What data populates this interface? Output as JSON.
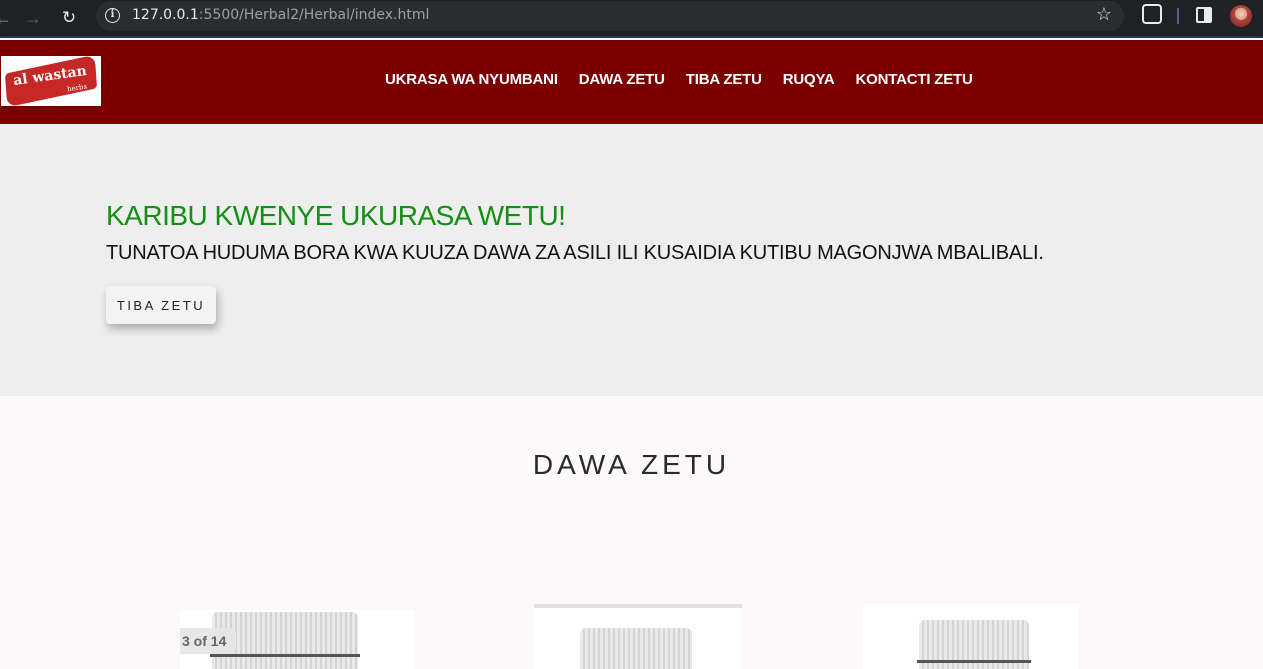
{
  "browser": {
    "url_host": "127.0.0.1",
    "url_rest": ":5500/Herbal2/Herbal/index.html"
  },
  "header": {
    "logo": {
      "text": "al wastan",
      "sub": "herbs",
      "color": "#c62828"
    },
    "nav": [
      {
        "label": "UKRASA WA NYUMBANI"
      },
      {
        "label": "DAWA ZETU"
      },
      {
        "label": "TIBA ZETU"
      },
      {
        "label": "RUQYA"
      },
      {
        "label": "KONTACTI ZETU"
      }
    ],
    "bg_color": "#7a0000"
  },
  "hero": {
    "title": "KARIBU KWENYE UKURASA WETU!",
    "subtitle": "TUNATOA HUDUMA BORA KWA KUUZA DAWA ZA ASILI ILI KUSAIDIA KUTIBU MAGONJWA MBALIBALI.",
    "button_label": "TIBA ZETU",
    "title_color": "#138f13"
  },
  "products": {
    "title": "DAWA ZETU",
    "carousel_counter": "3 of 14"
  }
}
